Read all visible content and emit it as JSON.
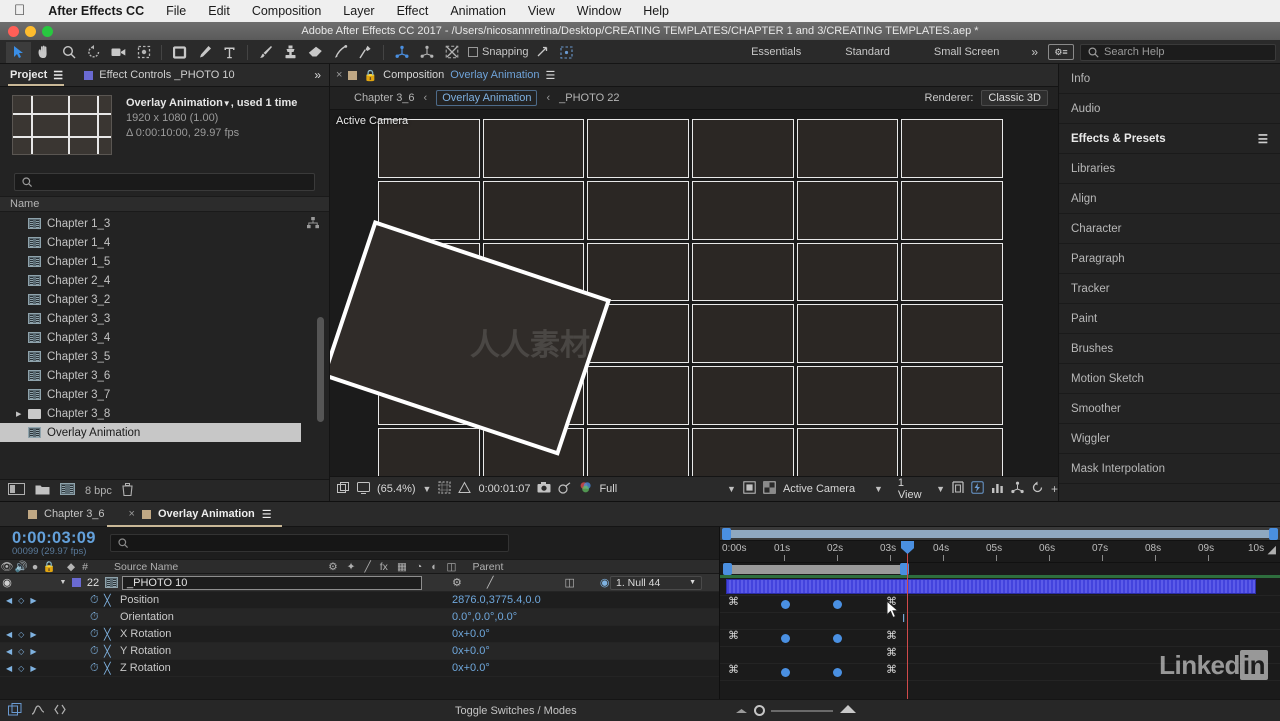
{
  "macmenu": {
    "apple_icon": "apple-icon",
    "items": [
      "After Effects CC",
      "File",
      "Edit",
      "Composition",
      "Layer",
      "Effect",
      "Animation",
      "View",
      "Window",
      "Help"
    ]
  },
  "titlebar": {
    "title": "Adobe After Effects CC 2017 - /Users/nicosannretina/Desktop/CREATING TEMPLATES/CHAPTER 1 and 3/CREATING TEMPLATES.aep *"
  },
  "toolbar": {
    "tools": [
      {
        "name": "selection-tool-icon",
        "selected": true
      },
      {
        "name": "hand-tool-icon",
        "selected": false
      },
      {
        "name": "zoom-tool-icon",
        "selected": false
      },
      {
        "name": "rotation-tool-icon",
        "selected": false
      },
      {
        "name": "camera-tool-icon",
        "selected": false
      },
      {
        "name": "pan-behind-tool-icon",
        "selected": false
      },
      {
        "name": "shape-tool-icon",
        "selected": false
      },
      {
        "name": "pen-tool-icon",
        "selected": false
      },
      {
        "name": "type-tool-icon",
        "selected": false
      },
      {
        "name": "brush-tool-icon",
        "selected": false
      },
      {
        "name": "clone-stamp-tool-icon",
        "selected": false
      },
      {
        "name": "eraser-tool-icon",
        "selected": false
      },
      {
        "name": "roto-brush-tool-icon",
        "selected": false
      },
      {
        "name": "puppet-pin-tool-icon",
        "selected": false
      }
    ],
    "axis_tools": [
      "local-axis-icon",
      "world-axis-icon",
      "view-axis-icon"
    ],
    "snapping_label": "Snapping",
    "snapping_checked": false,
    "workspaces": [
      "Essentials",
      "Standard",
      "Small Screen"
    ],
    "overflow_label": "»",
    "search_placeholder": "Search Help"
  },
  "project": {
    "tabs": [
      {
        "label": "Project",
        "active": true
      },
      {
        "label": "Effect Controls _PHOTO 10",
        "active": false
      }
    ],
    "selected_item": {
      "name": "Overlay Animation",
      "used": ", used 1 time",
      "dimensions": "1920 x 1080 (1.00)",
      "duration": "Δ 0:00:10:00, 29.97 fps"
    },
    "search_placeholder": "",
    "column_header": "Name",
    "items": [
      {
        "label": "Chapter 1_3",
        "type": "comp",
        "selected": false,
        "expandable": false
      },
      {
        "label": "Chapter 1_4",
        "type": "comp",
        "selected": false,
        "expandable": false
      },
      {
        "label": "Chapter 1_5",
        "type": "comp",
        "selected": false,
        "expandable": false
      },
      {
        "label": "Chapter 2_4",
        "type": "comp",
        "selected": false,
        "expandable": false
      },
      {
        "label": "Chapter 3_2",
        "type": "comp",
        "selected": false,
        "expandable": false
      },
      {
        "label": "Chapter 3_3",
        "type": "comp",
        "selected": false,
        "expandable": false
      },
      {
        "label": "Chapter 3_4",
        "type": "comp",
        "selected": false,
        "expandable": false
      },
      {
        "label": "Chapter 3_5",
        "type": "comp",
        "selected": false,
        "expandable": false
      },
      {
        "label": "Chapter 3_6",
        "type": "comp",
        "selected": false,
        "expandable": false
      },
      {
        "label": "Chapter 3_7",
        "type": "comp",
        "selected": false,
        "expandable": false
      },
      {
        "label": "Chapter 3_8",
        "type": "folder",
        "selected": false,
        "expandable": true
      },
      {
        "label": "Overlay Animation",
        "type": "comp",
        "selected": true,
        "expandable": false
      }
    ],
    "footer": {
      "bit_depth": "8 bpc"
    }
  },
  "composition": {
    "tab_label": "Composition",
    "tab_name": "Overlay Animation",
    "breadcrumb": [
      {
        "label": "Chapter 3_6",
        "current": false
      },
      {
        "label": "Overlay Animation",
        "current": true
      },
      {
        "label": "_PHOTO 22",
        "current": false
      }
    ],
    "renderer_label": "Renderer:",
    "renderer_value": "Classic 3D",
    "view_overlay": "Active Camera",
    "grid": {
      "columns": 6,
      "rows": 6
    },
    "viewer_footer": {
      "zoom": "(65.4%)",
      "timecode": "0:00:01:07",
      "resolution": "Full",
      "camera": "Active Camera",
      "views": "1 View"
    }
  },
  "right_panel": {
    "items": [
      {
        "label": "Info",
        "active": false,
        "menu": false
      },
      {
        "label": "Audio",
        "active": false,
        "menu": false
      },
      {
        "label": "Effects & Presets",
        "active": true,
        "menu": true
      },
      {
        "label": "Libraries",
        "active": false,
        "menu": false
      },
      {
        "label": "Align",
        "active": false,
        "menu": false
      },
      {
        "label": "Character",
        "active": false,
        "menu": false
      },
      {
        "label": "Paragraph",
        "active": false,
        "menu": false
      },
      {
        "label": "Tracker",
        "active": false,
        "menu": false
      },
      {
        "label": "Paint",
        "active": false,
        "menu": false
      },
      {
        "label": "Brushes",
        "active": false,
        "menu": false
      },
      {
        "label": "Motion Sketch",
        "active": false,
        "menu": false
      },
      {
        "label": "Smoother",
        "active": false,
        "menu": false
      },
      {
        "label": "Wiggler",
        "active": false,
        "menu": false
      },
      {
        "label": "Mask Interpolation",
        "active": false,
        "menu": false
      }
    ]
  },
  "timeline": {
    "tabs": [
      {
        "label": "Chapter 3_6",
        "active": false
      },
      {
        "label": "Overlay Animation",
        "active": true
      }
    ],
    "current_time": "0:00:03:09",
    "frame_info": "00099 (29.97 fps)",
    "search_placeholder": "",
    "columns": {
      "source_name": "Source Name",
      "parent": "Parent"
    },
    "layer": {
      "index": "22",
      "name": "_PHOTO 10",
      "parent": "1. Null 44",
      "properties": [
        {
          "name": "Position",
          "value": "2876.0,3775.4,0.0",
          "stopwatch": true,
          "has_keys": true
        },
        {
          "name": "Orientation",
          "value": "0.0°,0.0°,0.0°",
          "stopwatch": true,
          "has_keys": false
        },
        {
          "name": "X Rotation",
          "value": "0x+0.0°",
          "stopwatch": true,
          "has_keys": true
        },
        {
          "name": "Y Rotation",
          "value": "0x+0.0°",
          "stopwatch": true,
          "has_keys": true
        },
        {
          "name": "Z Rotation",
          "value": "0x+0.0°",
          "stopwatch": true,
          "has_keys": true
        }
      ]
    },
    "ruler_ticks": [
      "0:00s",
      "01s",
      "02s",
      "03s",
      "04s",
      "05s",
      "06s",
      "07s",
      "08s",
      "09s",
      "10s"
    ],
    "footer_label": "Toggle Switches / Modes"
  },
  "watermarks": {
    "linked_in": "Linked",
    "linked_in_badge": "in"
  },
  "colors": {
    "accent_blue": "#63a0da",
    "tab_underline": "#c9b897",
    "playhead_red": "#d04a4a",
    "keyframe_blue": "#4a90e2",
    "layer_bar": "#4343dd",
    "work_green": "#2e6e3e"
  }
}
